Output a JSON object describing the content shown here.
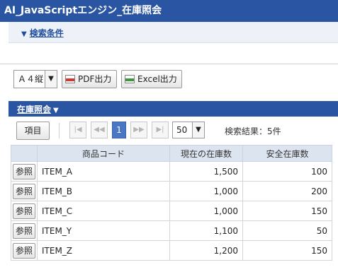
{
  "title": "AI_JavaScriptエンジン_在庫照会",
  "search": {
    "label": "検索条件"
  },
  "toolbar": {
    "paper_size": "Ａ４縦",
    "pdf_label": "PDF出力",
    "excel_label": "Excel出力"
  },
  "section": {
    "title": "在庫照会"
  },
  "pager": {
    "columns_button": "項目",
    "current_page": "1",
    "page_size": "50",
    "result_text": "検索結果：5件"
  },
  "table": {
    "headers": [
      "",
      "商品コード",
      "現在の在庫数",
      "安全在庫数"
    ],
    "ref_label": "参照",
    "rows": [
      {
        "code": "ITEM_A",
        "current": "1,500",
        "safety": "100"
      },
      {
        "code": "ITEM_B",
        "current": "1,000",
        "safety": "200"
      },
      {
        "code": "ITEM_C",
        "current": "1,000",
        "safety": "150"
      },
      {
        "code": "ITEM_Y",
        "current": "1,100",
        "safety": "50"
      },
      {
        "code": "ITEM_Z",
        "current": "1,200",
        "safety": "150"
      }
    ]
  },
  "icons": {
    "search_toggle": "triangle-down-icon",
    "pdf": "pdf-file-icon",
    "excel": "csv-file-icon",
    "first": "first-page-icon",
    "prev": "prev-page-icon",
    "next": "next-page-icon",
    "last": "last-page-icon"
  },
  "colors": {
    "header": "#2a55a3",
    "link": "#1f4f9c",
    "current_page": "#4a77c4"
  }
}
